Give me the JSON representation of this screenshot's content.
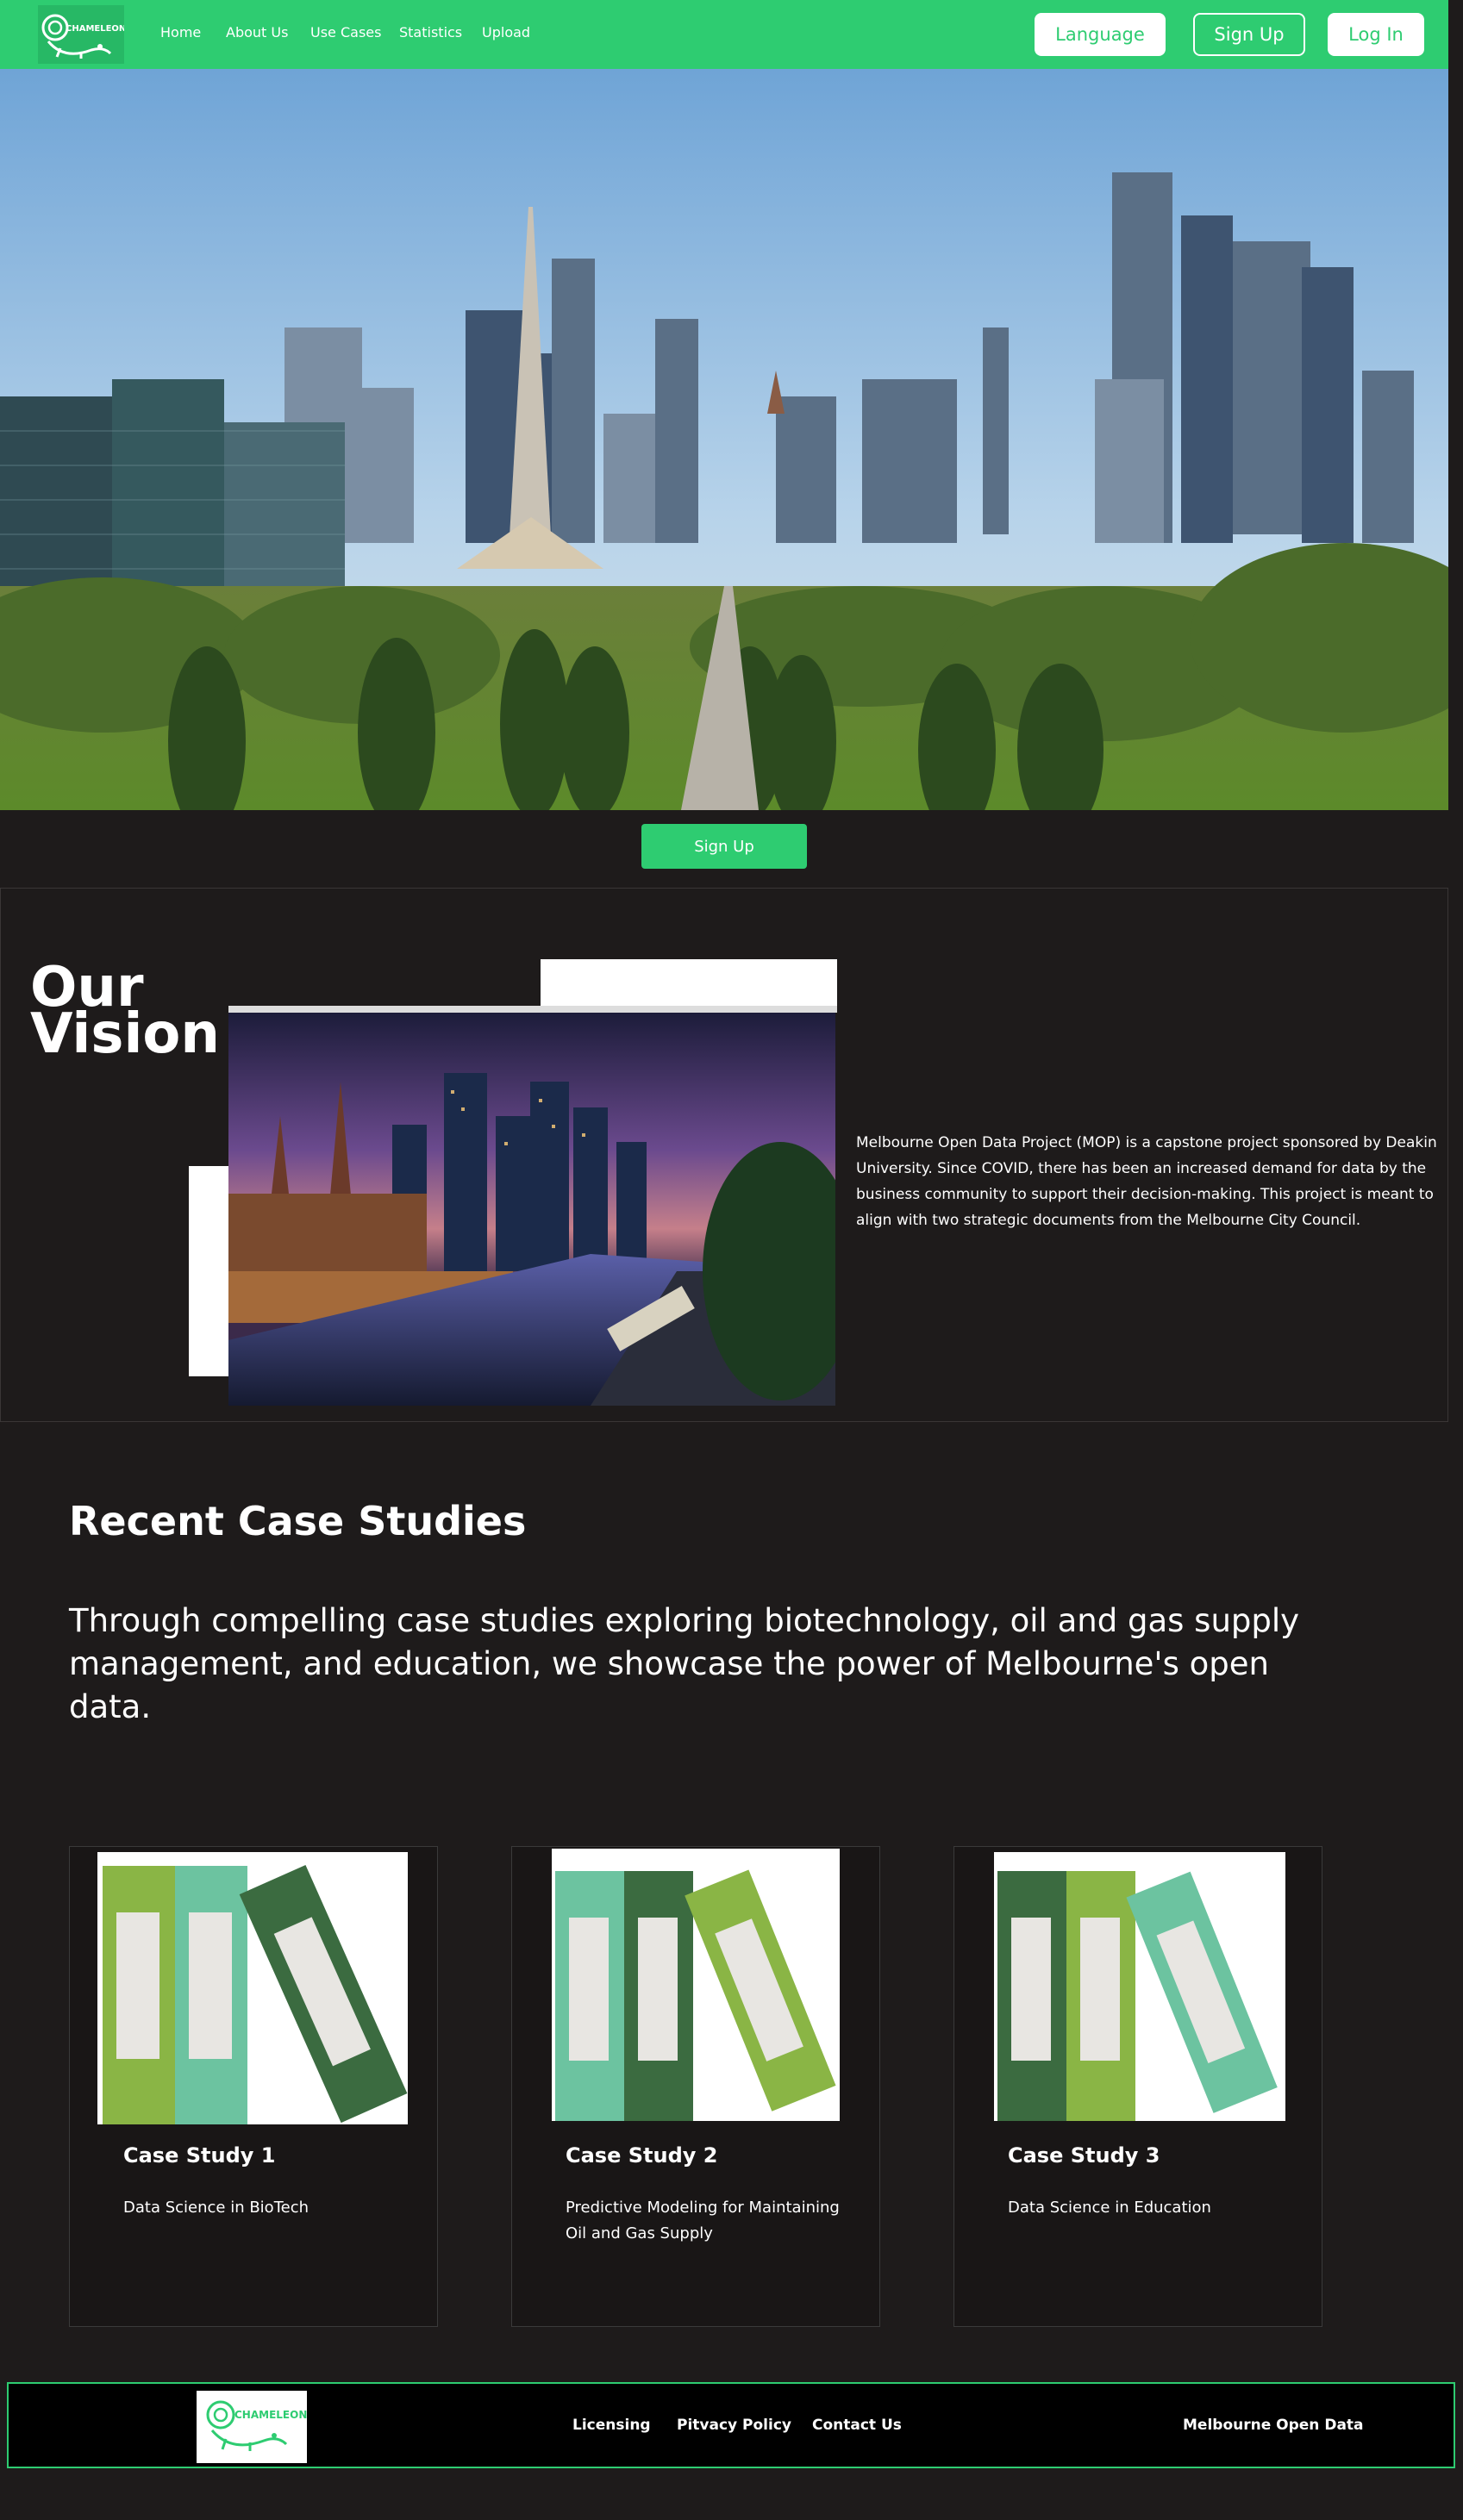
{
  "nav": {
    "logo_text": "CHAMELEON",
    "links": [
      "Home",
      "About Us",
      "Use Cases",
      "Statistics",
      "Upload"
    ],
    "language_label": "Language",
    "signup_label": "Sign Up",
    "login_label": "Log In"
  },
  "hero": {
    "signup_label": "Sign Up"
  },
  "vision": {
    "title_line1": "Our",
    "title_line2": "Vision",
    "text": "Melbourne Open Data Project (MOP) is a capstone project sponsored by Deakin University. Since COVID, there has been an increased demand for data by the business community to support their decision-making. This project is meant to align with two strategic documents from the Melbourne City Council."
  },
  "case_studies": {
    "title": "Recent Case Studies",
    "subtitle": "Through compelling case studies exploring biotechnology, oil and gas supply management, and education, we showcase the power of Melbourne's open data.",
    "cards": [
      {
        "title": "Case Study 1",
        "desc": "Data Science in BioTech"
      },
      {
        "title": "Case Study 2",
        "desc": "Predictive Modeling for Maintaining Oil and Gas Supply"
      },
      {
        "title": "Case Study 3",
        "desc": "Data Science in Education"
      }
    ]
  },
  "footer": {
    "logo_text": "CHAMELEON",
    "links": [
      "Licensing",
      "Pitvacy Policy",
      "Contact Us"
    ],
    "right_text": "Melbourne Open Data"
  },
  "colors": {
    "accent": "#2ecc71",
    "background": "#1e1b1b",
    "binder_light_green": "#8ab545",
    "binder_teal": "#6cc3a0",
    "binder_dark_green": "#3b6b40"
  }
}
